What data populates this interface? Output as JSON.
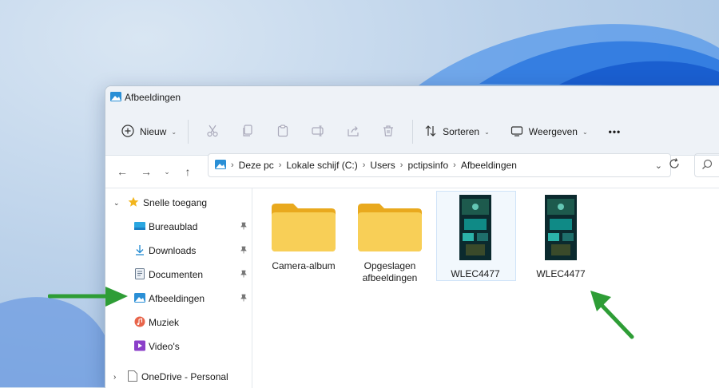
{
  "window": {
    "title": "Afbeeldingen"
  },
  "toolbar": {
    "new_label": "Nieuw",
    "sort_label": "Sorteren",
    "view_label": "Weergeven",
    "more_label": "•••"
  },
  "address": {
    "crumbs": [
      "Deze pc",
      "Lokale schijf (C:)",
      "Users",
      "pctipsinfo",
      "Afbeeldingen"
    ]
  },
  "sidebar": {
    "quick_access": "Snelle toegang",
    "items": [
      {
        "label": "Bureaublad",
        "icon": "desktop-icon",
        "pinned": true
      },
      {
        "label": "Downloads",
        "icon": "download-icon",
        "pinned": true
      },
      {
        "label": "Documenten",
        "icon": "document-icon",
        "pinned": true
      },
      {
        "label": "Afbeeldingen",
        "icon": "pictures-icon",
        "pinned": true
      },
      {
        "label": "Muziek",
        "icon": "music-icon",
        "pinned": false
      },
      {
        "label": "Video's",
        "icon": "video-icon",
        "pinned": false
      }
    ],
    "onedrive": "OneDrive - Personal"
  },
  "files": [
    {
      "name": "Camera-album",
      "type": "folder"
    },
    {
      "name_line1": "Opgeslagen",
      "name_line2": "afbeeldingen",
      "type": "folder"
    },
    {
      "name": "WLEC4477",
      "type": "image",
      "selected": true
    },
    {
      "name": "WLEC4477",
      "type": "image",
      "selected": false
    }
  ],
  "colors": {
    "annotation_arrow": "#2e9d36",
    "folder": "#f6c84b",
    "accent": "#0067c0"
  }
}
